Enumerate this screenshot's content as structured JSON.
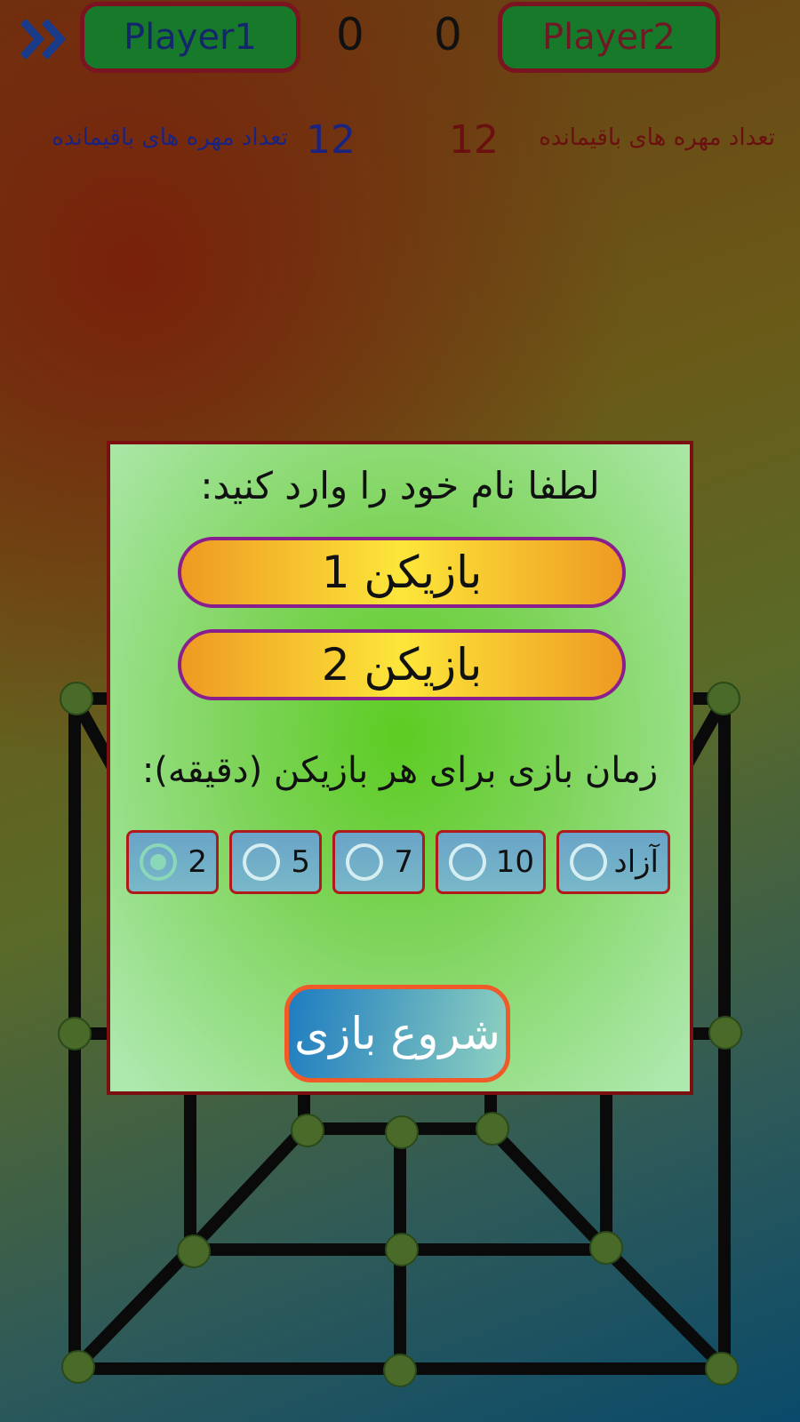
{
  "header": {
    "player1_label": "Player1",
    "player2_label": "Player2",
    "player1_score": "0",
    "player2_score": "0",
    "player1_remaining_label": "تعداد مهره های باقیمانده",
    "player1_remaining_count": "12",
    "player2_remaining_label": "تعداد مهره های باقیمانده",
    "player2_remaining_count": "12",
    "menu_icon": "double-chevron-right-icon"
  },
  "dialog": {
    "title": "لطفا نام خود را وارد کنید:",
    "player1_name": "بازیکن 1",
    "player2_name": "بازیکن 2",
    "time_label": "زمان بازی برای هر بازیکن (دقیقه):",
    "time_options": [
      {
        "label": "2",
        "selected": true
      },
      {
        "label": "5",
        "selected": false
      },
      {
        "label": "7",
        "selected": false
      },
      {
        "label": "10",
        "selected": false
      },
      {
        "label": "آزاد",
        "selected": false
      }
    ],
    "start_label": "شروع بازی"
  },
  "colors": {
    "player_button_bg": "#177a2a",
    "player_button_border": "#7a1420",
    "player1_text": "#15276b",
    "player2_text": "#6e1a25",
    "dialog_border": "#7a1010",
    "name_field_border": "#8a1e8e",
    "start_button_border": "#f05a28"
  }
}
